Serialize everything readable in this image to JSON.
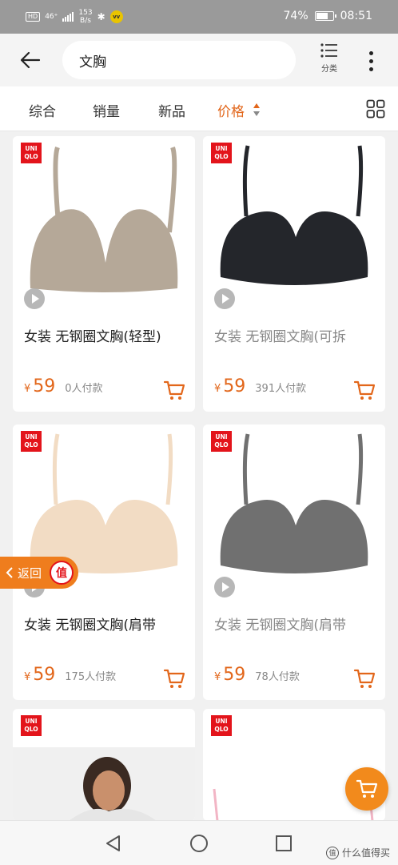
{
  "status_bar": {
    "hd": "HD",
    "signal": "46⁺",
    "speed": "153\nB/s",
    "battery_pct": "74%",
    "battery_level": 0.74,
    "time": "08:51",
    "icons": [
      "hd-icon",
      "signal-icon",
      "bluetooth-icon",
      "vv-icon",
      "battery-icon"
    ]
  },
  "header": {
    "search_value": "文胸",
    "category_label": "分类",
    "icons": [
      "back-arrow-icon",
      "list-icon",
      "more-vertical-icon"
    ]
  },
  "sort_bar": {
    "tabs": [
      {
        "label": "综合",
        "active": false
      },
      {
        "label": "销量",
        "active": false
      },
      {
        "label": "新品",
        "active": false
      },
      {
        "label": "价格",
        "active": true
      }
    ],
    "icons": [
      "sort-arrows-icon",
      "grid-view-icon"
    ]
  },
  "brand_logo": "UNI\nQLO",
  "products": [
    {
      "title": "女装 无钢圈文胸(轻型)",
      "currency": "¥",
      "price": "59",
      "sold": "0人付款",
      "title_dim": false,
      "color": "#b5a898",
      "style": "plunge"
    },
    {
      "title": "女装 无钢圈文胸(可拆",
      "currency": "¥",
      "price": "59",
      "sold": "391人付款",
      "title_dim": true,
      "color": "#24262b",
      "style": "bandeau"
    },
    {
      "title": "女装 无钢圈文胸(肩带",
      "currency": "¥",
      "price": "59",
      "sold": "175人付款",
      "title_dim": false,
      "color": "#f2dcc4",
      "style": "bandeau"
    },
    {
      "title": "女装 无钢圈文胸(肩带",
      "currency": "¥",
      "price": "59",
      "sold": "78人付款",
      "title_dim": true,
      "color": "#707070",
      "style": "bandeau"
    }
  ],
  "return_button": {
    "label": "返回",
    "badge": "值"
  },
  "accent_color": "#e2661a",
  "watermark": {
    "logo": "值",
    "text": "什么值得买"
  }
}
